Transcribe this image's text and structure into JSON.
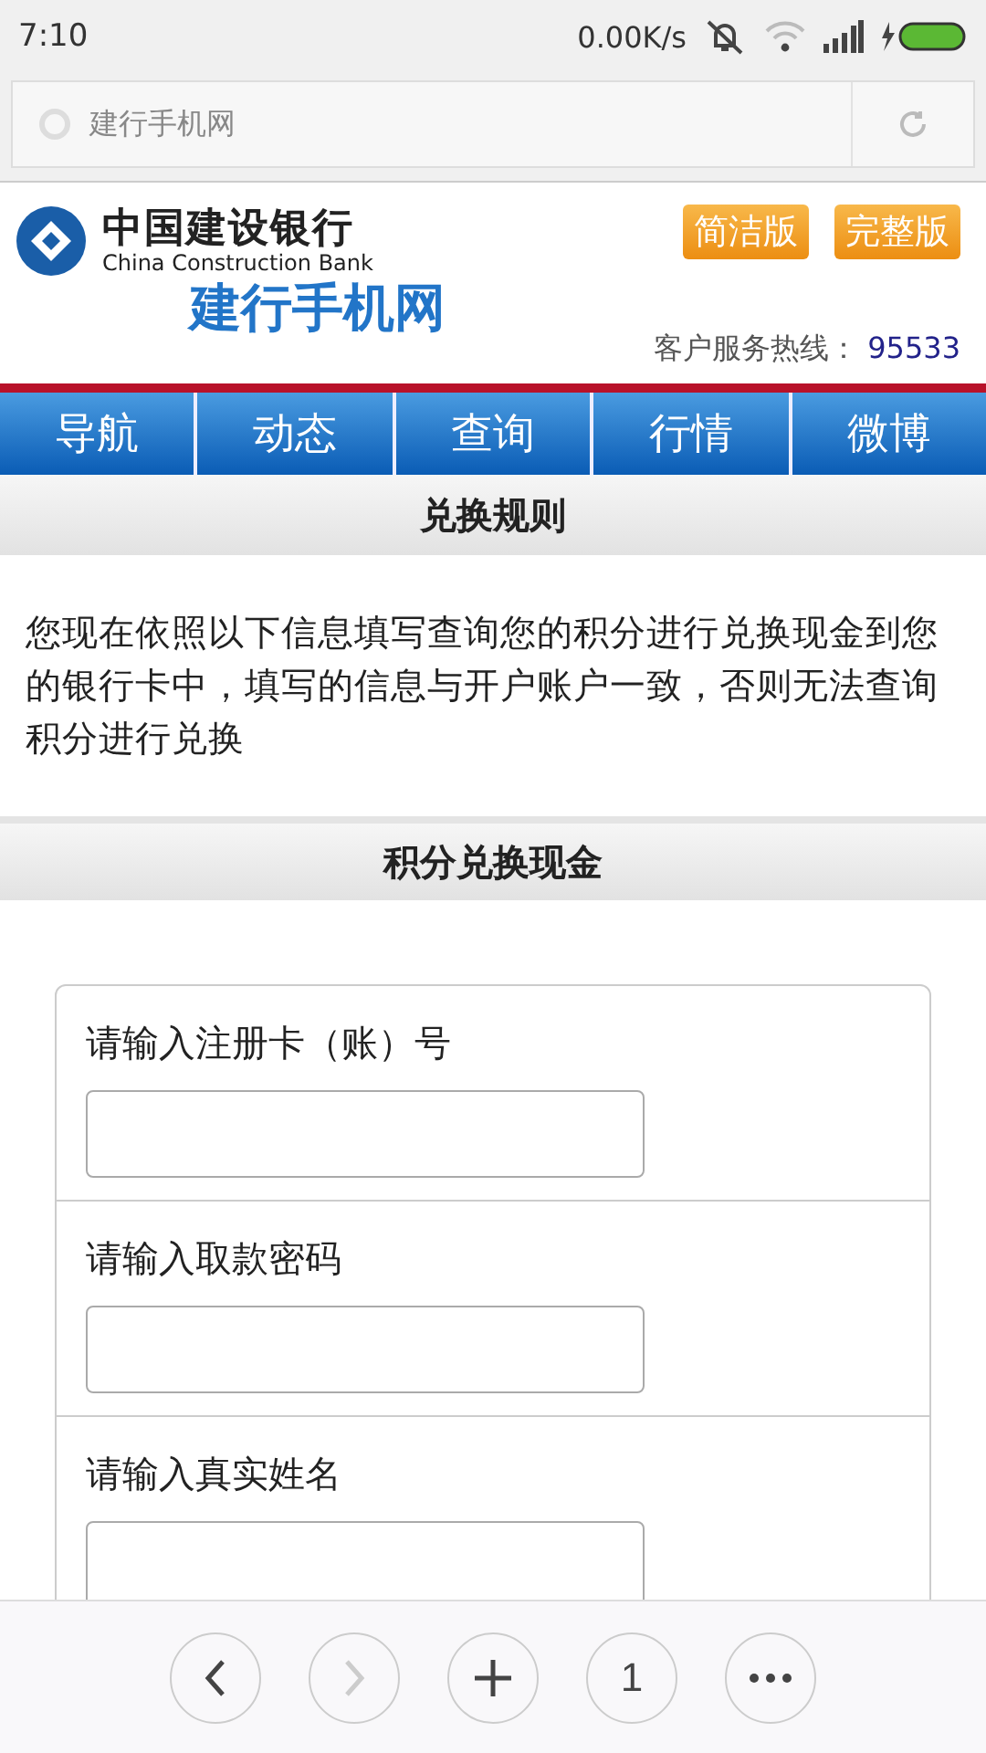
{
  "status_bar": {
    "time": "7:10",
    "speed": "0.00K/s"
  },
  "address_bar": {
    "title": "建行手机网"
  },
  "header": {
    "bank_name": "中国建设银行",
    "bank_name_en": "China Construction Bank",
    "site_name": "建行手机网",
    "version_buttons": [
      "简洁版",
      "完整版"
    ],
    "hotline_label": "客户服务热线：",
    "hotline_number": "95533"
  },
  "nav": [
    {
      "label": "导航"
    },
    {
      "label": "动态"
    },
    {
      "label": "查询"
    },
    {
      "label": "行情"
    },
    {
      "label": "微博"
    }
  ],
  "rules_section": {
    "title": "兑换规则",
    "text": "您现在依照以下信息填写查询您的积分进行兑换现金到您的银行卡中，填写的信息与开户账户一致，否则无法查询积分进行兑换"
  },
  "form_section": {
    "title": "积分兑换现金",
    "fields": [
      {
        "label": "请输入注册卡（账）号"
      },
      {
        "label": "请输入取款密码"
      },
      {
        "label": "请输入真实姓名"
      }
    ]
  },
  "browser_toolbar": [
    {
      "kind": "back",
      "disabled": false
    },
    {
      "kind": "forward",
      "disabled": true
    },
    {
      "kind": "new-tab",
      "disabled": false
    },
    {
      "kind": "tabs",
      "count": "1",
      "disabled": false
    },
    {
      "kind": "more",
      "disabled": false
    }
  ]
}
